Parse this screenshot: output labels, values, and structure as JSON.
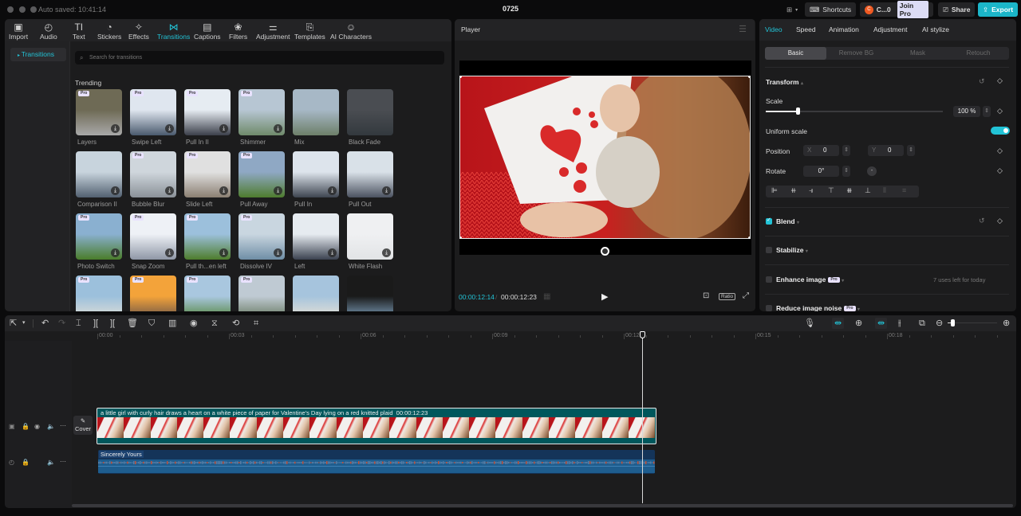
{
  "titlebar": {
    "autosave": "Auto saved: 10:41:14",
    "project_title": "0725",
    "shortcuts": "Shortcuts",
    "account_initial": "C",
    "account_name": "C...0",
    "join_pro": "Join Pro",
    "share": "Share",
    "export": "Export"
  },
  "media_tabs": [
    {
      "label": "Import",
      "icon": "import-icon",
      "glyph": "▣"
    },
    {
      "label": "Audio",
      "icon": "audio-icon",
      "glyph": "◴"
    },
    {
      "label": "Text",
      "icon": "text-icon",
      "glyph": "TI"
    },
    {
      "label": "Stickers",
      "icon": "stickers-icon",
      "glyph": "◔"
    },
    {
      "label": "Effects",
      "icon": "effects-icon",
      "glyph": "✧"
    },
    {
      "label": "Transitions",
      "icon": "transitions-icon",
      "glyph": "⋈"
    },
    {
      "label": "Captions",
      "icon": "captions-icon",
      "glyph": "▤"
    },
    {
      "label": "Filters",
      "icon": "filters-icon",
      "glyph": "❀"
    },
    {
      "label": "Adjustment",
      "icon": "adjustment-icon",
      "glyph": "⚌"
    },
    {
      "label": "Templates",
      "icon": "templates-icon",
      "glyph": "⎘"
    },
    {
      "label": "AI Characters",
      "icon": "ai-characters-icon",
      "glyph": "☺"
    }
  ],
  "left_nav": {
    "active": "Transitions"
  },
  "search": {
    "placeholder": "Search for transitions"
  },
  "section_title": "Trending",
  "transitions": [
    {
      "name": "Layers",
      "pro": true,
      "download": true
    },
    {
      "name": "Swipe Left",
      "pro": true,
      "download": true
    },
    {
      "name": "Pull In II",
      "pro": true,
      "download": true
    },
    {
      "name": "Shimmer",
      "pro": true,
      "download": true
    },
    {
      "name": "Mix",
      "pro": false,
      "download": false
    },
    {
      "name": "Black Fade",
      "pro": false,
      "download": false
    },
    {
      "name": "Comparison II",
      "pro": false,
      "download": true
    },
    {
      "name": "Bubble Blur",
      "pro": true,
      "download": true
    },
    {
      "name": "Slide Left",
      "pro": true,
      "download": true
    },
    {
      "name": "Pull Away",
      "pro": true,
      "download": true
    },
    {
      "name": "Pull In",
      "pro": false,
      "download": true
    },
    {
      "name": "Pull Out",
      "pro": false,
      "download": true
    },
    {
      "name": "Photo Switch",
      "pro": true,
      "download": true
    },
    {
      "name": "Snap Zoom",
      "pro": true,
      "download": true
    },
    {
      "name": "Pull th...en left",
      "pro": true,
      "download": true
    },
    {
      "name": "Dissolve IV",
      "pro": true,
      "download": true
    },
    {
      "name": "Left",
      "pro": false,
      "download": true
    },
    {
      "name": "White Flash",
      "pro": false,
      "download": true
    },
    {
      "name": "",
      "pro": true,
      "download": false
    },
    {
      "name": "",
      "pro": true,
      "download": false
    },
    {
      "name": "",
      "pro": true,
      "download": false
    },
    {
      "name": "",
      "pro": true,
      "download": false
    },
    {
      "name": "",
      "pro": false,
      "download": false
    },
    {
      "name": "",
      "pro": false,
      "download": false
    }
  ],
  "player": {
    "title": "Player",
    "current_time": "00:00:12:14",
    "separator": "/",
    "total_time": "00:00:12:23",
    "ratio": "Ratio"
  },
  "inspector": {
    "tabs": [
      "Video",
      "Speed",
      "Animation",
      "Adjustment",
      "AI stylize"
    ],
    "active_tab": "Video",
    "subtabs": [
      "Basic",
      "Remove BG",
      "Mask",
      "Retouch"
    ],
    "active_subtab": "Basic",
    "transform_label": "Transform",
    "scale_label": "Scale",
    "scale_value": "100 %",
    "scale_fraction": 0.18,
    "uniform_scale_label": "Uniform scale",
    "uniform_scale_on": true,
    "position_label": "Position",
    "position_x_label": "X",
    "position_x": "0",
    "position_y_label": "Y",
    "position_y": "0",
    "rotate_label": "Rotate",
    "rotate_value": "0°",
    "blend_label": "Blend",
    "blend_checked": true,
    "stabilize_label": "Stabilize",
    "enhance_label": "Enhance image",
    "enhance_note": "7 uses left for today",
    "reduce_noise_label": "Reduce image noise",
    "pro_badge": "Pro"
  },
  "timeline": {
    "ruler": [
      "00:00",
      "00:03",
      "00:06",
      "00:09",
      "00:12",
      "00:15",
      "00:18"
    ],
    "cover_label": "Cover",
    "video_clip_title": "a little girl with curly hair draws a heart on a white piece of paper for Valentine's Day lying on a red knitted plaid",
    "video_clip_duration": "00:00:12:23",
    "audio_clip_title": "Sincerely Yours",
    "zoom_fraction": 0.1
  },
  "colors": {
    "accent": "#22c3d6",
    "video_clip": "#00575c",
    "audio_clip": "#143459"
  }
}
